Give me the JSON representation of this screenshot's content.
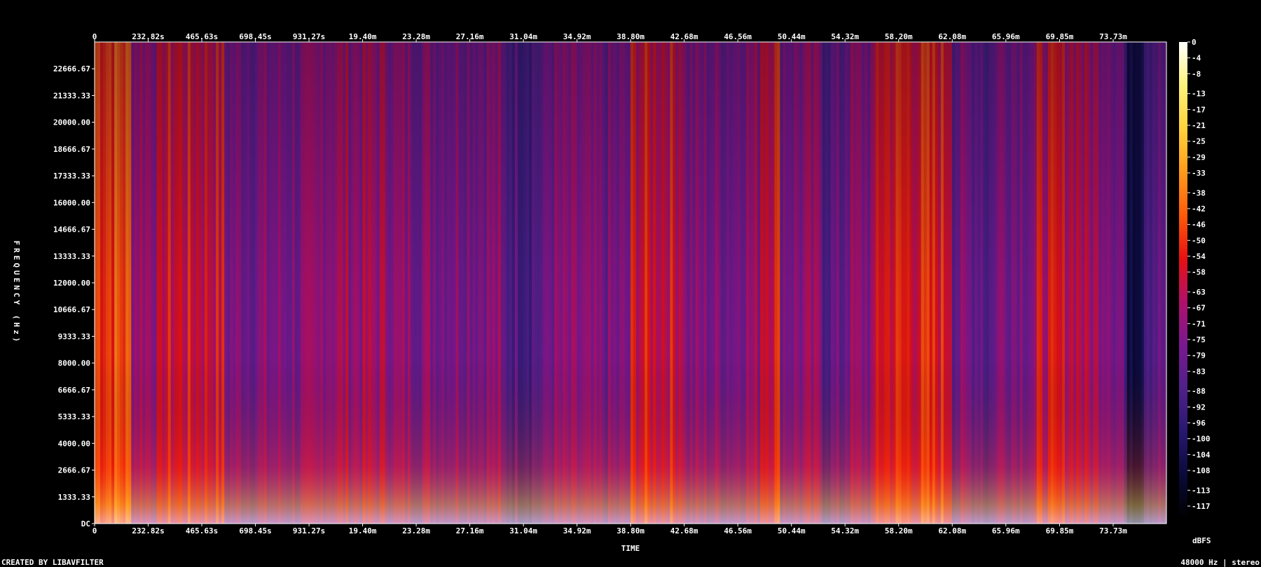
{
  "chart_data": {
    "type": "heatmap",
    "title": "",
    "xlabel": "TIME",
    "ylabel": "FREQUENCY (Hz)",
    "x_ticks_top": [
      "0",
      "232.82s",
      "465.63s",
      "698.45s",
      "931.27s",
      "19.40m",
      "23.28m",
      "27.16m",
      "31.04m",
      "34.92m",
      "38.80m",
      "42.68m",
      "46.56m",
      "50.44m",
      "54.32m",
      "58.20m",
      "62.08m",
      "65.96m",
      "69.85m",
      "73.73m"
    ],
    "x_ticks_bottom": [
      "0",
      "232.82s",
      "465.63s",
      "698.45s",
      "931.27s",
      "19.40m",
      "23.28m",
      "27.16m",
      "31.04m",
      "34.92m",
      "38.80m",
      "42.68m",
      "46.56m",
      "50.44m",
      "54.32m",
      "58.20m",
      "62.08m",
      "65.96m",
      "69.85m",
      "73.73m"
    ],
    "x_tick_seconds": [
      0,
      232.82,
      465.63,
      698.45,
      931.27,
      1164,
      1396.8,
      1629.6,
      1862.4,
      2095.2,
      2328,
      2560.8,
      2793.6,
      3026.4,
      3259.2,
      3492,
      3724.8,
      3957.6,
      4191,
      4423.8
    ],
    "xlim_seconds": [
      0,
      4655
    ],
    "y_ticks": [
      "22666.67",
      "21333.33",
      "20000.00",
      "18666.67",
      "17333.33",
      "16000.00",
      "14666.67",
      "13333.33",
      "12000.00",
      "10666.67",
      "9333.33",
      "8000.00",
      "6666.67",
      "5333.33",
      "4000.00",
      "2666.67",
      "1333.33",
      "DC"
    ],
    "y_tick_values_hz": [
      22666.67,
      21333.33,
      20000,
      18666.67,
      17333.33,
      16000,
      14666.67,
      13333.33,
      12000,
      10666.67,
      9333.33,
      8000,
      6666.67,
      5333.33,
      4000,
      2666.67,
      1333.33,
      0
    ],
    "ylim_hz": [
      0,
      24000
    ],
    "colorbar": {
      "label": "dBFS",
      "ticks": [
        "0",
        "-4",
        "-8",
        "-13",
        "-17",
        "-21",
        "-25",
        "-29",
        "-33",
        "-38",
        "-42",
        "-46",
        "-50",
        "-54",
        "-58",
        "-63",
        "-67",
        "-71",
        "-75",
        "-79",
        "-83",
        "-88",
        "-92",
        "-96",
        "-100",
        "-104",
        "-108",
        "-113",
        "-117"
      ],
      "range_db": [
        0,
        -120
      ],
      "colors": [
        "#ffffff",
        "#fff27a",
        "#ffd23a",
        "#ff9a1a",
        "#ff5a0a",
        "#e81010",
        "#b0106a",
        "#7a1890",
        "#50208a",
        "#281870",
        "#0a0a3a",
        "#000000"
      ]
    },
    "segments": [
      {
        "start": 0,
        "end": 0.035,
        "level": 0.62
      },
      {
        "start": 0.035,
        "end": 0.063,
        "level": 0.45
      },
      {
        "start": 0.063,
        "end": 0.12,
        "level": 0.52
      },
      {
        "start": 0.12,
        "end": 0.21,
        "level": 0.38
      },
      {
        "start": 0.21,
        "end": 0.28,
        "level": 0.44
      },
      {
        "start": 0.28,
        "end": 0.38,
        "level": 0.4
      },
      {
        "start": 0.38,
        "end": 0.42,
        "level": 0.3
      },
      {
        "start": 0.42,
        "end": 0.46,
        "level": 0.38
      },
      {
        "start": 0.46,
        "end": 0.5,
        "level": 0.36
      },
      {
        "start": 0.5,
        "end": 0.55,
        "level": 0.52
      },
      {
        "start": 0.55,
        "end": 0.6,
        "level": 0.38
      },
      {
        "start": 0.6,
        "end": 0.62,
        "level": 0.42
      },
      {
        "start": 0.62,
        "end": 0.64,
        "level": 0.55
      },
      {
        "start": 0.64,
        "end": 0.68,
        "level": 0.4
      },
      {
        "start": 0.68,
        "end": 0.7,
        "level": 0.32
      },
      {
        "start": 0.7,
        "end": 0.73,
        "level": 0.4
      },
      {
        "start": 0.73,
        "end": 0.8,
        "level": 0.55
      },
      {
        "start": 0.8,
        "end": 0.83,
        "level": 0.36
      },
      {
        "start": 0.83,
        "end": 0.84,
        "level": 0.3
      },
      {
        "start": 0.84,
        "end": 0.88,
        "level": 0.4
      },
      {
        "start": 0.88,
        "end": 0.92,
        "level": 0.5
      },
      {
        "start": 0.92,
        "end": 0.95,
        "level": 0.45
      },
      {
        "start": 0.95,
        "end": 0.96,
        "level": 0.38
      },
      {
        "start": 0.96,
        "end": 0.98,
        "level": 0.16
      },
      {
        "start": 0.98,
        "end": 1.0,
        "level": 0.32
      }
    ]
  },
  "footer": {
    "credit": "CREATED BY LIBAVFILTER",
    "info": "48000 Hz | stereo"
  }
}
